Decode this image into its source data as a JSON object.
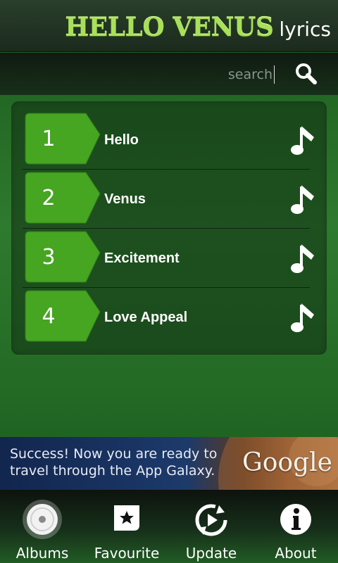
{
  "header": {
    "title_main": "HELLO VENUS",
    "title_sub": "lyrics"
  },
  "search": {
    "placeholder": "search",
    "value": ""
  },
  "songs": [
    {
      "number": "1",
      "title": "Hello"
    },
    {
      "number": "2",
      "title": "Venus"
    },
    {
      "number": "3",
      "title": "Excitement"
    },
    {
      "number": "4",
      "title": "Love Appeal"
    }
  ],
  "ad": {
    "text": "Success! Now you are ready to travel through the App Galaxy.",
    "brand": "Google"
  },
  "nav": [
    {
      "label": "Albums",
      "icon": "album-disc-icon"
    },
    {
      "label": "Favourite",
      "icon": "star-icon"
    },
    {
      "label": "Update",
      "icon": "update-icon"
    },
    {
      "label": "About",
      "icon": "info-icon"
    }
  ],
  "colors": {
    "accent": "#44a81e",
    "title_green": "#a9e05a"
  }
}
